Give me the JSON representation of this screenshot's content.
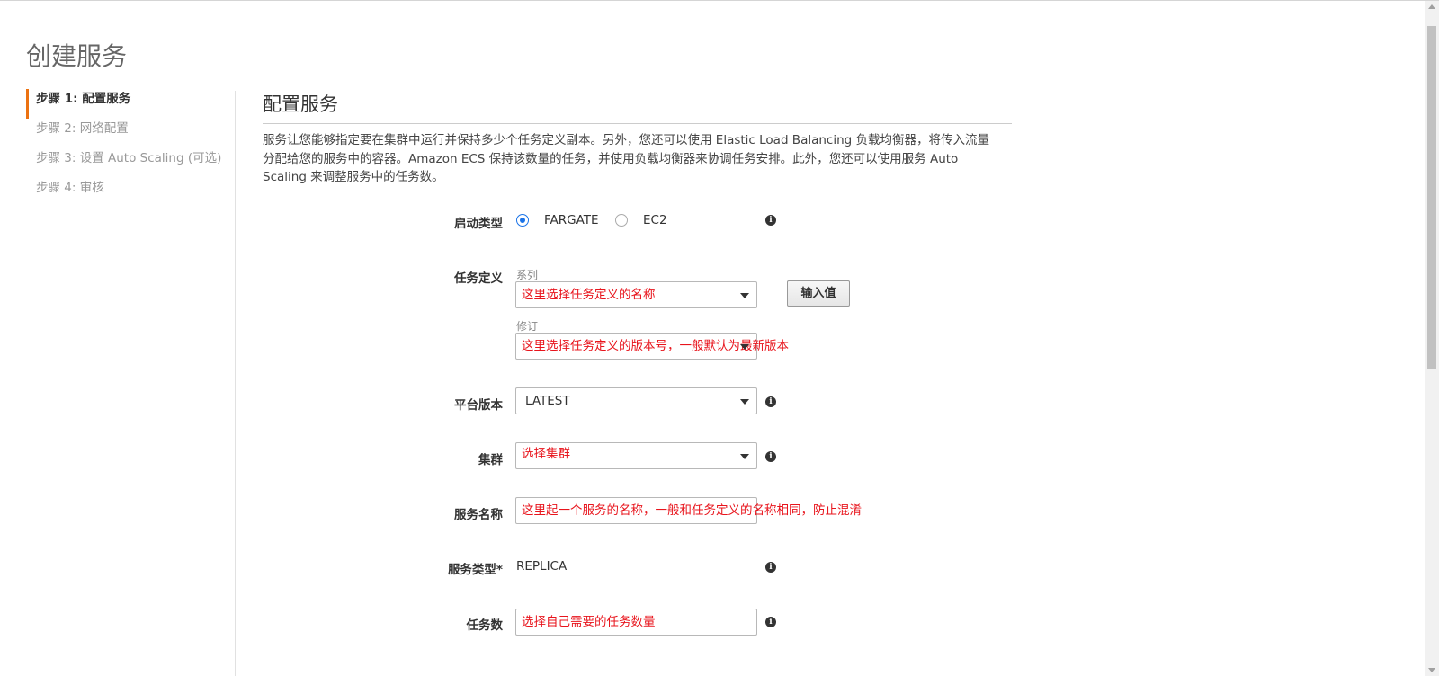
{
  "page": {
    "title": "创建服务"
  },
  "steps": [
    {
      "label": "步骤 1: 配置服务",
      "active": true
    },
    {
      "label": "步骤 2: 网络配置",
      "active": false
    },
    {
      "label": "步骤 3: 设置 Auto Scaling (可选)",
      "active": false
    },
    {
      "label": "步骤 4: 审核",
      "active": false
    }
  ],
  "section": {
    "title": "配置服务",
    "description": "服务让您能够指定要在集群中运行并保持多少个任务定义副本。另外，您还可以使用 Elastic Load Balancing 负载均衡器，将传入流量分配给您的服务中的容器。Amazon ECS 保持该数量的任务，并使用负载均衡器来协调任务安排。此外，您还可以使用服务 Auto Scaling 来调整服务中的任务数。"
  },
  "form": {
    "launch_type": {
      "label": "启动类型",
      "options": [
        "FARGATE",
        "EC2"
      ],
      "selected": "FARGATE"
    },
    "task_definition": {
      "label": "任务定义",
      "family_label": "系列",
      "family_value": "这里选择任务定义的名称",
      "revision_label": "修订",
      "revision_value": "这里选择任务定义的版本号，一般默认为最新版本",
      "enter_value_button": "输入值"
    },
    "platform_version": {
      "label": "平台版本",
      "value": "LATEST"
    },
    "cluster": {
      "label": "集群",
      "value": "选择集群"
    },
    "service_name": {
      "label": "服务名称",
      "value": "这里起一个服务的名称，一般和任务定义的名称相同，防止混淆"
    },
    "service_type": {
      "label": "服务类型*",
      "value": "REPLICA"
    },
    "task_count": {
      "label": "任务数",
      "value": "选择自己需要的任务数量"
    }
  },
  "icons": {
    "info": "info-icon",
    "radio_checked_color": "#1a73e8",
    "annotation_color": "#e8141c",
    "active_step_accent": "#ec7211"
  }
}
